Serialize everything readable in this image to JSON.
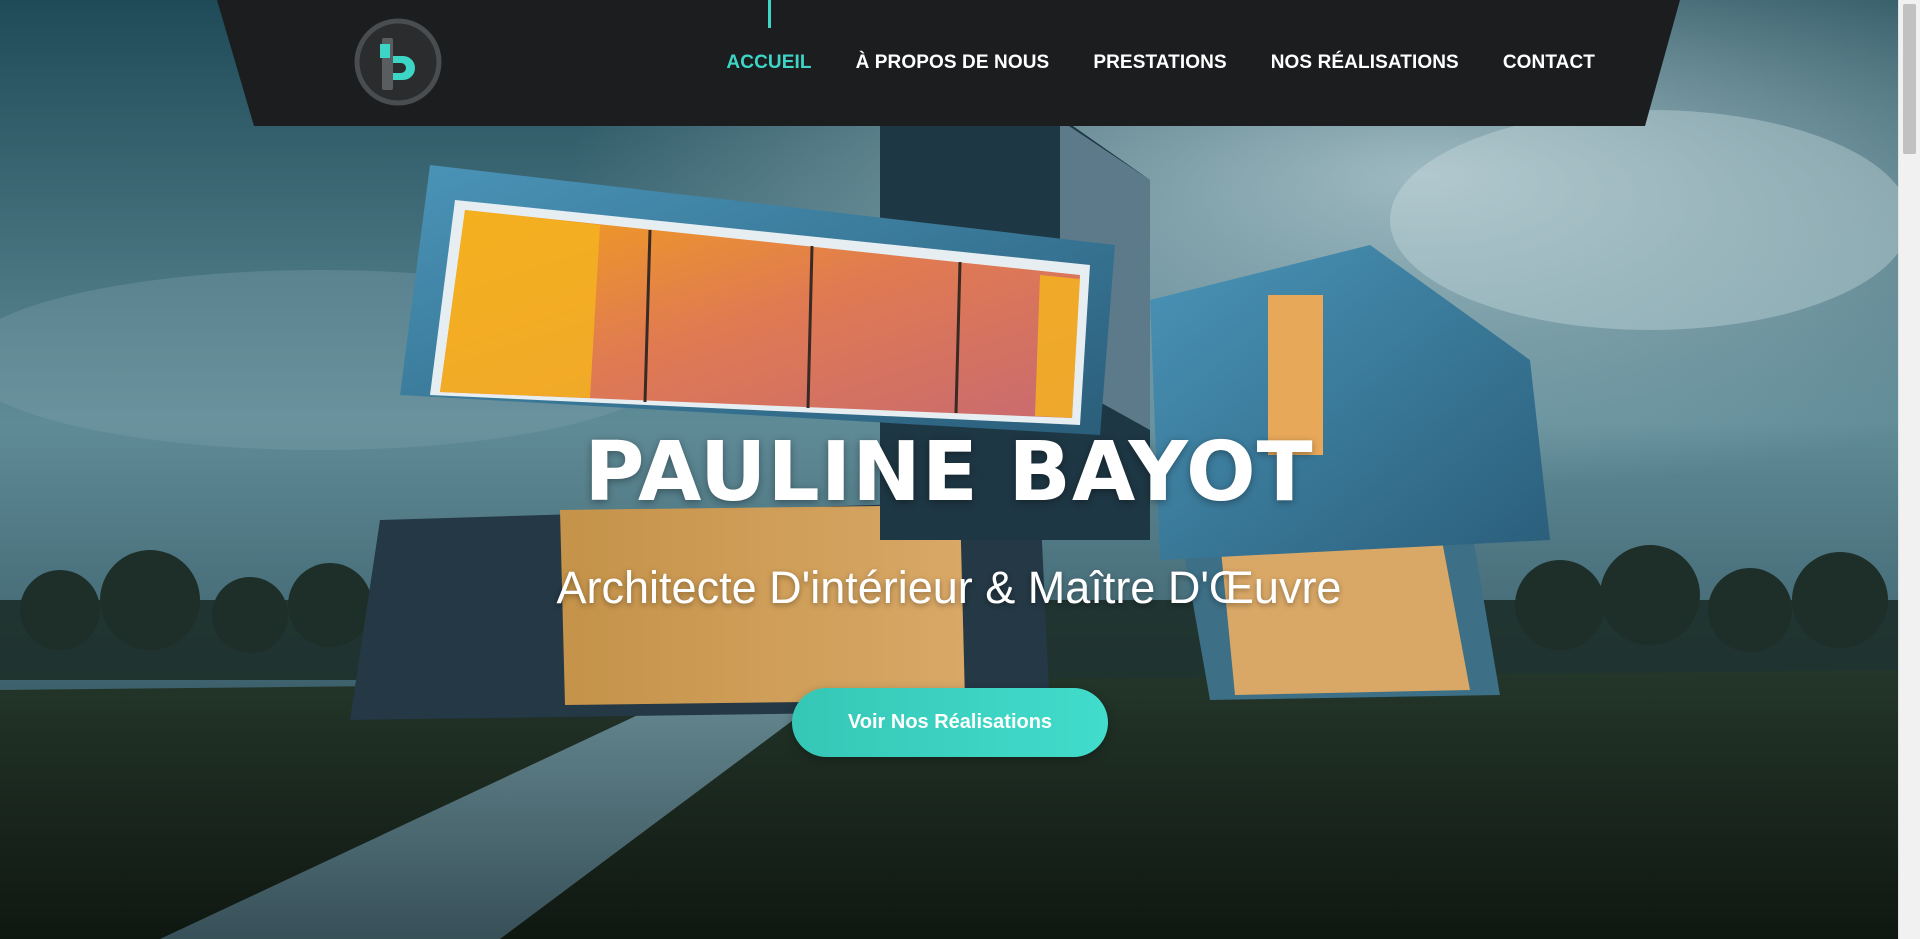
{
  "header": {
    "logo_letter": "B",
    "nav": [
      {
        "label": "ACCUEIL",
        "active": true
      },
      {
        "label": "À PROPOS DE NOUS",
        "active": false
      },
      {
        "label": "PRESTATIONS",
        "active": false
      },
      {
        "label": "NOS RÉALISATIONS",
        "active": false
      },
      {
        "label": "CONTACT",
        "active": false
      }
    ]
  },
  "hero": {
    "title": "PAULINE BAYOT",
    "subtitle": "Architecte D'intérieur & Maître D'Œuvre",
    "cta_label": "Voir Nos Réalisations"
  },
  "colors": {
    "accent": "#3dd6c6",
    "header_bg": "#1b1d1f",
    "text": "#ffffff"
  },
  "icons": {
    "logo": "pb-monogram-logo"
  }
}
